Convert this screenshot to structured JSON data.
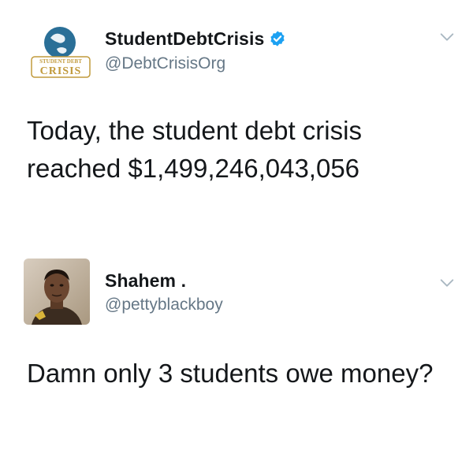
{
  "tweets": [
    {
      "display_name": "StudentDebtCrisis",
      "verified": true,
      "handle": "@DebtCrisisOrg",
      "avatar_icon": "student-debt-crisis-logo",
      "avatar_logo_text": "CRISIS",
      "avatar_logo_subtext": "STUDENT DEBT",
      "text_line1": "Today, the student debt crisis",
      "text_line2": "reached $1,499,246,043,056"
    },
    {
      "display_name": "Shahem .",
      "verified": false,
      "handle": "@pettyblackboy",
      "avatar_icon": "profile-photo",
      "text_line1": "Damn only 3 students owe money?"
    }
  ],
  "colors": {
    "text": "#14171a",
    "handle": "#657786",
    "verified_blue": "#1da1f2",
    "chevron": "#aab8c2"
  }
}
